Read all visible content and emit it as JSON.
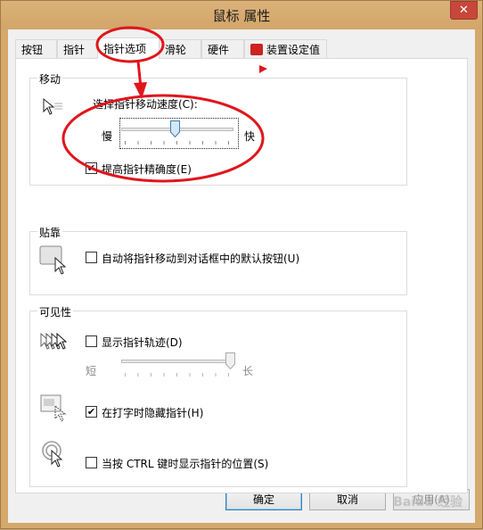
{
  "window": {
    "title": "鼠标 属性",
    "close_glyph": "✕"
  },
  "tabs": [
    {
      "label": "按钮"
    },
    {
      "label": "指针"
    },
    {
      "label": "指针选项",
      "active": true
    },
    {
      "label": "滑轮"
    },
    {
      "label": "硬件"
    },
    {
      "label": "装置设定值",
      "icon": "device-settings-icon"
    }
  ],
  "motion": {
    "group_title": "移动",
    "speed_label": "选择指针移动速度(C):",
    "slow_label": "慢",
    "fast_label": "快",
    "speed_value_fraction": 0.5,
    "precision_label": "提高指针精确度(E)",
    "precision_checked": true
  },
  "snap": {
    "group_title": "贴靠",
    "snap_label": "自动将指针移动到对话框中的默认按钮(U)",
    "snap_checked": false
  },
  "visibility": {
    "group_title": "可见性",
    "trails_label": "显示指针轨迹(D)",
    "trails_checked": false,
    "short_label": "短",
    "long_label": "长",
    "trails_value_fraction": 1.0,
    "hide_label": "在打字时隐藏指针(H)",
    "hide_checked": true,
    "ctrl_label": "当按 CTRL 键时显示指针的位置(S)",
    "ctrl_checked": false
  },
  "buttons": {
    "ok": "确定",
    "cancel": "取消",
    "apply": "应用(A)"
  },
  "watermark": "Baidu 经验",
  "colors": {
    "annotation_red": "#e0161d",
    "title_bar": "#d5a86b"
  }
}
